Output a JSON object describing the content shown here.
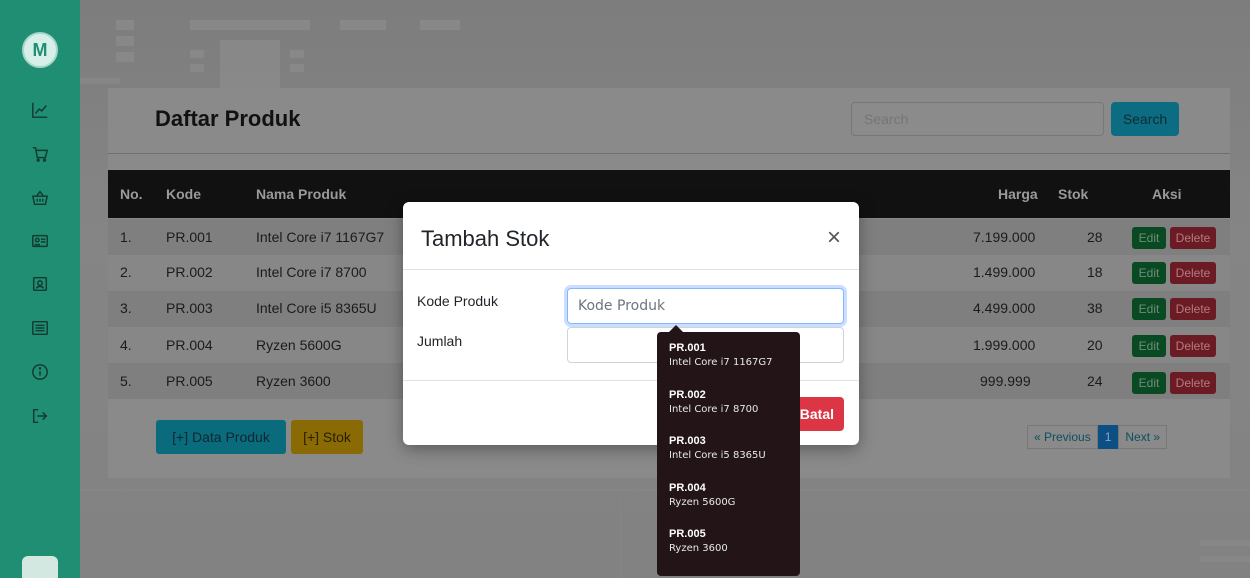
{
  "sidebar": {
    "logo_letter": "M",
    "icons": [
      "chart-line-icon",
      "cart-icon",
      "basket-icon",
      "id-card-icon",
      "user-card-icon",
      "list-icon",
      "info-icon",
      "logout-icon"
    ]
  },
  "header": {
    "title": "Daftar Produk",
    "search_placeholder": "Search",
    "search_button": "Search"
  },
  "table": {
    "columns": [
      "No.",
      "Kode",
      "Nama Produk",
      "Harga",
      "Stok",
      "Aksi"
    ],
    "rows": [
      {
        "no": "1.",
        "kode": "PR.001",
        "nama": "Intel Core i7 1167G7",
        "harga": "7.199.000",
        "stok": "28"
      },
      {
        "no": "2.",
        "kode": "PR.002",
        "nama": "Intel Core i7 8700",
        "harga": "1.499.000",
        "stok": "18"
      },
      {
        "no": "3.",
        "kode": "PR.003",
        "nama": "Intel Core i5 8365U",
        "harga": "4.499.000",
        "stok": "38"
      },
      {
        "no": "4.",
        "kode": "PR.004",
        "nama": "Ryzen 5600G",
        "harga": "1.999.000",
        "stok": "20"
      },
      {
        "no": "5.",
        "kode": "PR.005",
        "nama": "Ryzen 3600",
        "harga": "999.999",
        "stok": "24"
      }
    ],
    "edit_label": "Edit",
    "delete_label": "Delete"
  },
  "actions": {
    "add_product": "[+] Data Produk",
    "add_stock": "[+] Stok"
  },
  "pagination": {
    "previous": "« Previous",
    "current": "1",
    "next": "Next »"
  },
  "modal": {
    "title": "Tambah Stok",
    "close": "×",
    "kode_label": "Kode Produk",
    "kode_placeholder": "Kode Produk",
    "jumlah_label": "Jumlah",
    "jumlah_value": "",
    "cancel_button": "Batal"
  },
  "autocomplete": [
    {
      "code": "PR.001",
      "name": "Intel Core i7 1167G7"
    },
    {
      "code": "PR.002",
      "name": "Intel Core i7 8700"
    },
    {
      "code": "PR.003",
      "name": "Intel Core i5 8365U"
    },
    {
      "code": "PR.004",
      "name": "Ryzen 5600G"
    },
    {
      "code": "PR.005",
      "name": "Ryzen 3600"
    }
  ],
  "colors": {
    "sidebar": "#1f8e72",
    "modal_bg": "#ffffff",
    "danger": "#dc3545",
    "dropdown_bg": "#231517"
  }
}
